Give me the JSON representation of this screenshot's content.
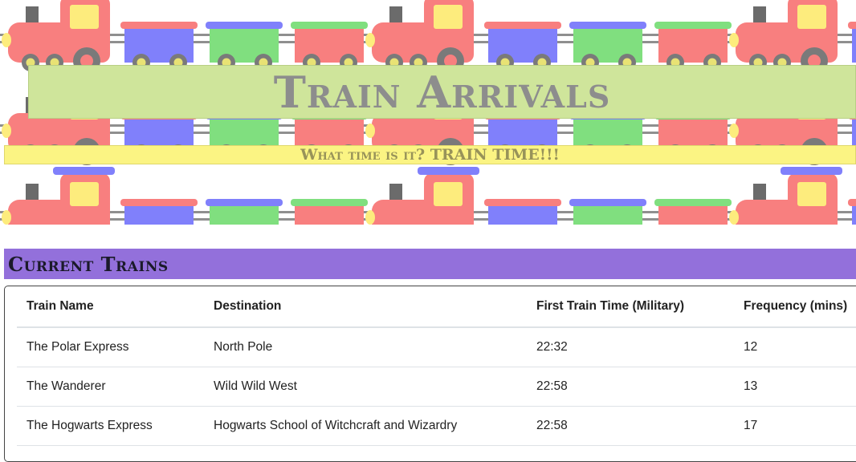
{
  "header": {
    "title": "Train Arrivals",
    "subtitle": "What time is it? TRAIN TIME!!!"
  },
  "section": {
    "title": "Current Trains"
  },
  "table": {
    "columns": [
      "Train Name",
      "Destination",
      "First Train Time (Military)",
      "Frequency (mins)"
    ],
    "rows": [
      [
        "The Polar Express",
        "North Pole",
        "22:32",
        "12"
      ],
      [
        "The Wanderer",
        "Wild Wild West",
        "22:58",
        "13"
      ],
      [
        "The Hogwarts Express",
        "Hogwarts School of Witchcraft and Wizardry",
        "22:58",
        "17"
      ]
    ]
  },
  "colors": {
    "title_box": "#cfe59b",
    "subtitle_box": "#fbf483",
    "section_header": "#9370db",
    "engine": "#f87f7f",
    "car_blue": "#8080fb",
    "car_green": "#80df7f",
    "car_red": "#f87f7f",
    "wheel": "#7a7a7a"
  },
  "banner_icons": [
    "toy-train-pattern"
  ]
}
